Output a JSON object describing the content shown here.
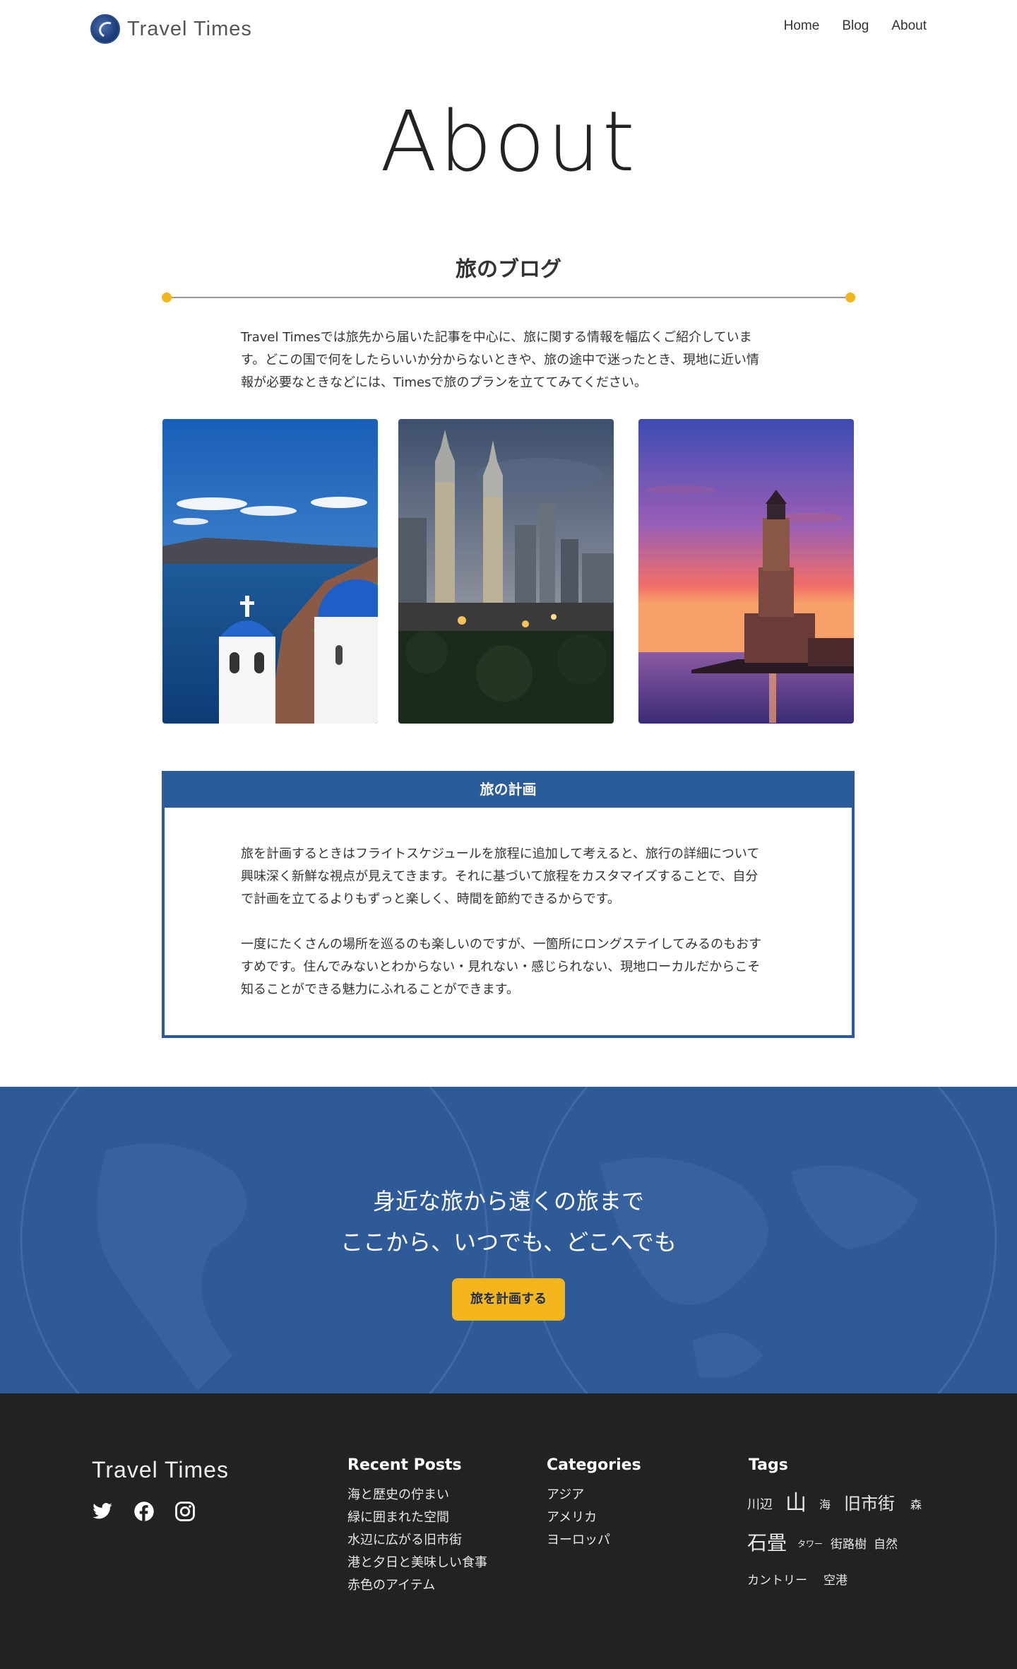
{
  "header": {
    "logo_text": "Travel Times",
    "nav": [
      "Home",
      "Blog",
      "About"
    ]
  },
  "page_title": "About",
  "section": {
    "heading": "旅のブログ",
    "intro_lines": [
      "Travel Timesでは旅先から届いた記事を中心に、旅に関する情報を幅広くご紹介していま",
      "す。どこの国で何をしたらいいか分からないときや、旅の途中で迷ったとき、現地に近い情",
      "報が必要なときなどには、Timesで旅のプランを立ててみてください。"
    ]
  },
  "photos": [
    {
      "subject": "santorini-blue-domes"
    },
    {
      "subject": "kuala-lumpur-towers"
    },
    {
      "subject": "lighthouse-sunset"
    }
  ],
  "plan": {
    "title": "旅の計画",
    "para1": [
      "旅を計画するときはフライトスケジュールを旅程に追加して考えると、旅行の詳細について",
      "興味深く新鮮な視点が見えてきます。それに基づいて旅程をカスタマイズすることで、自分",
      "で計画を立てるよりもずっと楽しく、時間を節約できるからです。"
    ],
    "para2": [
      "一度にたくさんの場所を巡るのも楽しいのですが、一箇所にロングステイしてみるのもおす",
      "すめです。住んでみないとわからない・見れない・感じられない、現地ローカルだからこそ",
      "知ることができる魅力にふれることができます。"
    ]
  },
  "cta": {
    "line1": "身近な旅から遠くの旅まで",
    "line2": "ここから、いつでも、どこへでも",
    "button": "旅を計画する"
  },
  "footer": {
    "brand": "Travel Times",
    "social_icons": [
      "twitter-icon",
      "facebook-icon",
      "instagram-icon"
    ],
    "recent_posts": {
      "title": "Recent Posts",
      "items": [
        "海と歴史の佇まい",
        "緑に囲まれた空間",
        "水辺に広がる旧市街",
        "港と夕日と美味しい食事",
        "赤色のアイテム"
      ]
    },
    "categories": {
      "title": "Categories",
      "items": [
        "アジア",
        "アメリカ",
        "ヨーロッパ"
      ]
    },
    "tags": {
      "title": "Tags",
      "items": [
        "川辺",
        "山",
        "海",
        "旧市街",
        "森",
        "石畳",
        "タワー",
        "街路樹",
        "自然",
        "カントリー",
        "空港"
      ]
    }
  },
  "colors": {
    "accent_yellow": "#f5b51c",
    "brand_blue": "#2a5b9a",
    "footer_bg": "#222222"
  }
}
